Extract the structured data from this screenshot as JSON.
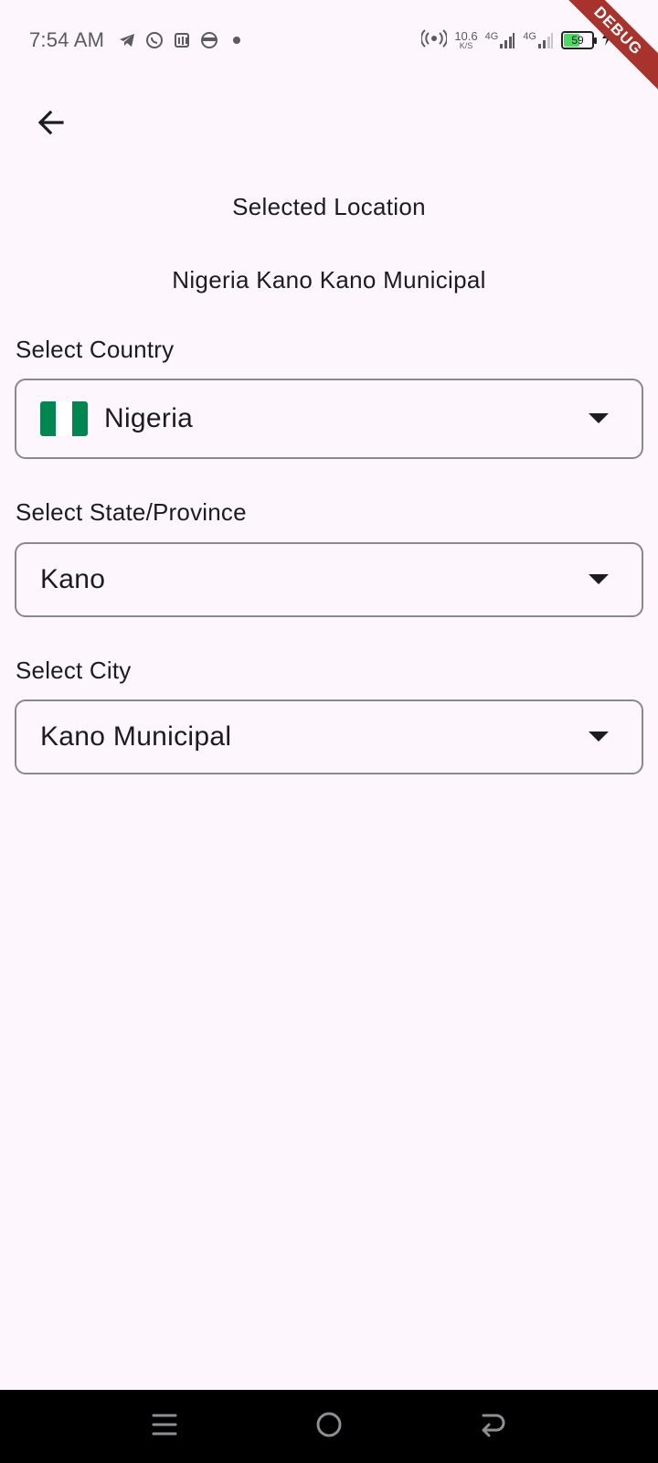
{
  "status_bar": {
    "time": "7:54 AM",
    "net_speed_value": "10.6",
    "net_speed_unit": "K/S",
    "network_1": "4G",
    "network_2": "4G",
    "battery_level": "59",
    "battery_fraction": 0.59,
    "left_icons": [
      "telegram-icon",
      "whatsapp-icon",
      "app-icon",
      "face-icon",
      "dot-icon"
    ],
    "right_icons": [
      "hotspot-icon",
      "signal-icon",
      "signal-icon",
      "battery-icon",
      "charging-icon"
    ]
  },
  "debug_banner": "DEBUG",
  "header": {
    "back_icon": "arrow-left-icon"
  },
  "selected": {
    "title": "Selected Location",
    "value": "Nigeria Kano Kano Municipal"
  },
  "country": {
    "label": "Select Country",
    "value": "Nigeria",
    "flag_colors": [
      "#008751",
      "#ffffff",
      "#008751"
    ]
  },
  "state": {
    "label": "Select State/Province",
    "value": "Kano"
  },
  "city": {
    "label": "Select City",
    "value": "Kano Municipal"
  },
  "nav": {
    "icons": [
      "menu-icon",
      "home-icon",
      "back-icon"
    ]
  },
  "colors": {
    "background": "#fdf7fd",
    "outline": "#8b8790",
    "text": "#1d1b20",
    "debug": "#a8322c"
  }
}
